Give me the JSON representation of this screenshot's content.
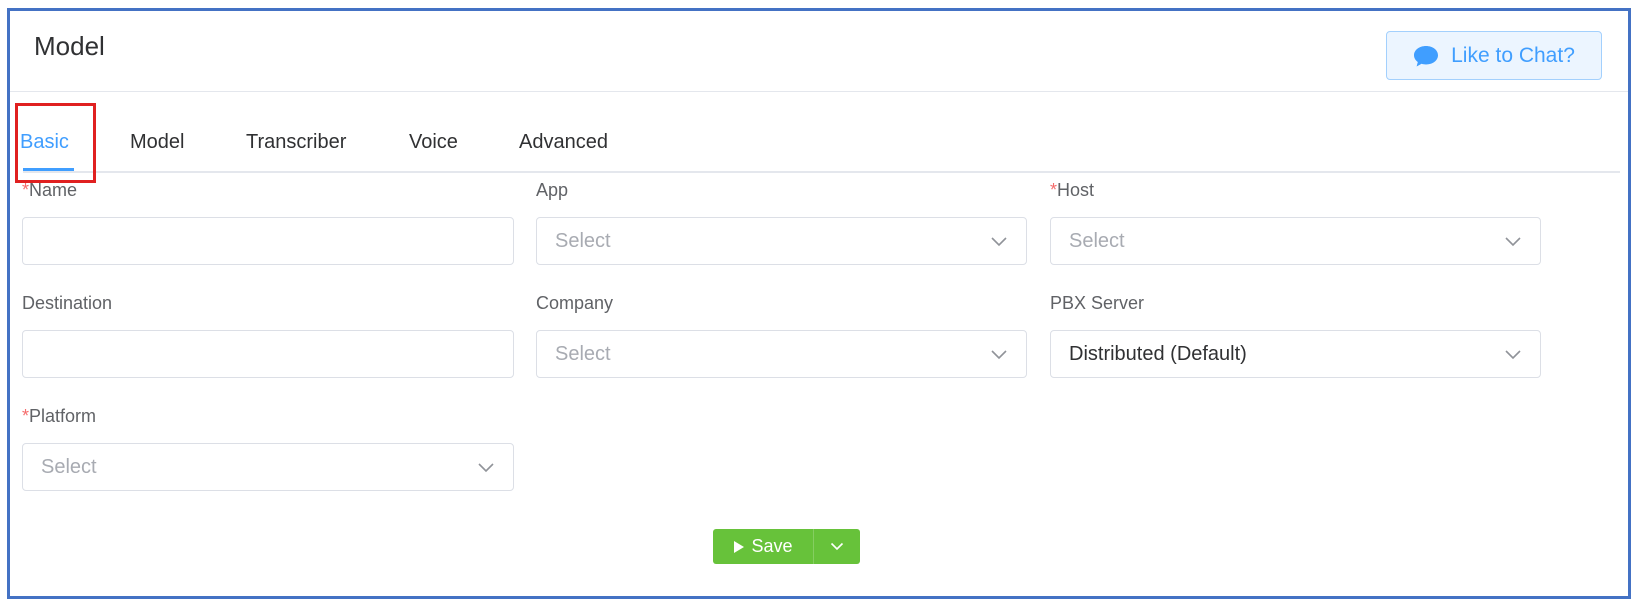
{
  "header": {
    "title": "Model",
    "chat_button_label": "Like to Chat?",
    "chat_icon": "chat-bubble-icon"
  },
  "tabs": [
    {
      "label": "Basic",
      "active": true
    },
    {
      "label": "Model",
      "active": false
    },
    {
      "label": "Transcriber",
      "active": false
    },
    {
      "label": "Voice",
      "active": false
    },
    {
      "label": "Advanced",
      "active": false
    }
  ],
  "form": {
    "name": {
      "label": "Name",
      "required": true,
      "value": ""
    },
    "app": {
      "label": "App",
      "required": false,
      "placeholder": "Select"
    },
    "host": {
      "label": "Host",
      "required": true,
      "placeholder": "Select"
    },
    "destination": {
      "label": "Destination",
      "required": false,
      "value": ""
    },
    "company": {
      "label": "Company",
      "required": false,
      "placeholder": "Select"
    },
    "pbx_server": {
      "label": "PBX Server",
      "required": false,
      "value": "Distributed (Default)"
    },
    "platform": {
      "label": "Platform",
      "required": true,
      "placeholder": "Select"
    }
  },
  "actions": {
    "save_label": "Save",
    "save_icon": "play-icon",
    "dropdown_icon": "chevron-down-icon"
  },
  "colors": {
    "accent": "#409eff",
    "required": "#f56c6c",
    "save": "#67c23a",
    "highlight": "#e02020",
    "frame_border": "#4472c4"
  }
}
